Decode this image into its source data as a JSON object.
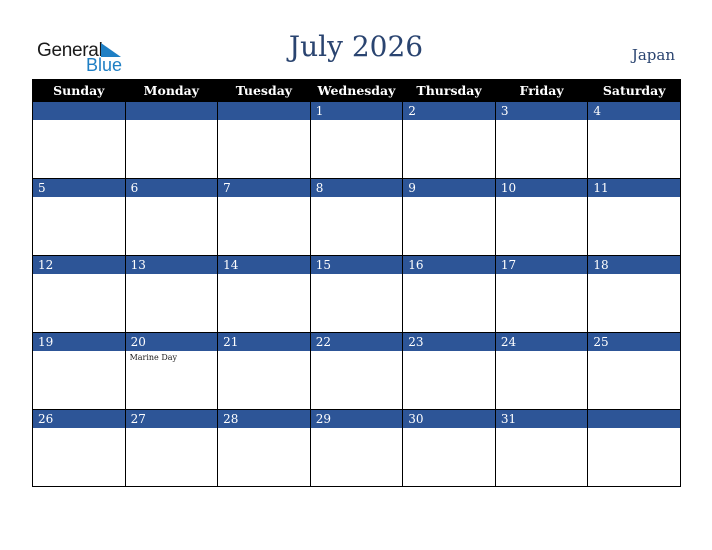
{
  "logo": {
    "line1": "General",
    "line2": "Blue",
    "brand_color": "#1f7fc4"
  },
  "title": "July 2026",
  "country": "Japan",
  "colors": {
    "header_bg": "#000000",
    "day_bar": "#2d5597",
    "title": "#2a4470"
  },
  "weekdays": [
    "Sunday",
    "Monday",
    "Tuesday",
    "Wednesday",
    "Thursday",
    "Friday",
    "Saturday"
  ],
  "weeks": [
    [
      {
        "day": "",
        "holiday": ""
      },
      {
        "day": "",
        "holiday": ""
      },
      {
        "day": "",
        "holiday": ""
      },
      {
        "day": "1",
        "holiday": ""
      },
      {
        "day": "2",
        "holiday": ""
      },
      {
        "day": "3",
        "holiday": ""
      },
      {
        "day": "4",
        "holiday": ""
      }
    ],
    [
      {
        "day": "5",
        "holiday": ""
      },
      {
        "day": "6",
        "holiday": ""
      },
      {
        "day": "7",
        "holiday": ""
      },
      {
        "day": "8",
        "holiday": ""
      },
      {
        "day": "9",
        "holiday": ""
      },
      {
        "day": "10",
        "holiday": ""
      },
      {
        "day": "11",
        "holiday": ""
      }
    ],
    [
      {
        "day": "12",
        "holiday": ""
      },
      {
        "day": "13",
        "holiday": ""
      },
      {
        "day": "14",
        "holiday": ""
      },
      {
        "day": "15",
        "holiday": ""
      },
      {
        "day": "16",
        "holiday": ""
      },
      {
        "day": "17",
        "holiday": ""
      },
      {
        "day": "18",
        "holiday": ""
      }
    ],
    [
      {
        "day": "19",
        "holiday": ""
      },
      {
        "day": "20",
        "holiday": "Marine Day"
      },
      {
        "day": "21",
        "holiday": ""
      },
      {
        "day": "22",
        "holiday": ""
      },
      {
        "day": "23",
        "holiday": ""
      },
      {
        "day": "24",
        "holiday": ""
      },
      {
        "day": "25",
        "holiday": ""
      }
    ],
    [
      {
        "day": "26",
        "holiday": ""
      },
      {
        "day": "27",
        "holiday": ""
      },
      {
        "day": "28",
        "holiday": ""
      },
      {
        "day": "29",
        "holiday": ""
      },
      {
        "day": "30",
        "holiday": ""
      },
      {
        "day": "31",
        "holiday": ""
      },
      {
        "day": "",
        "holiday": ""
      }
    ]
  ]
}
